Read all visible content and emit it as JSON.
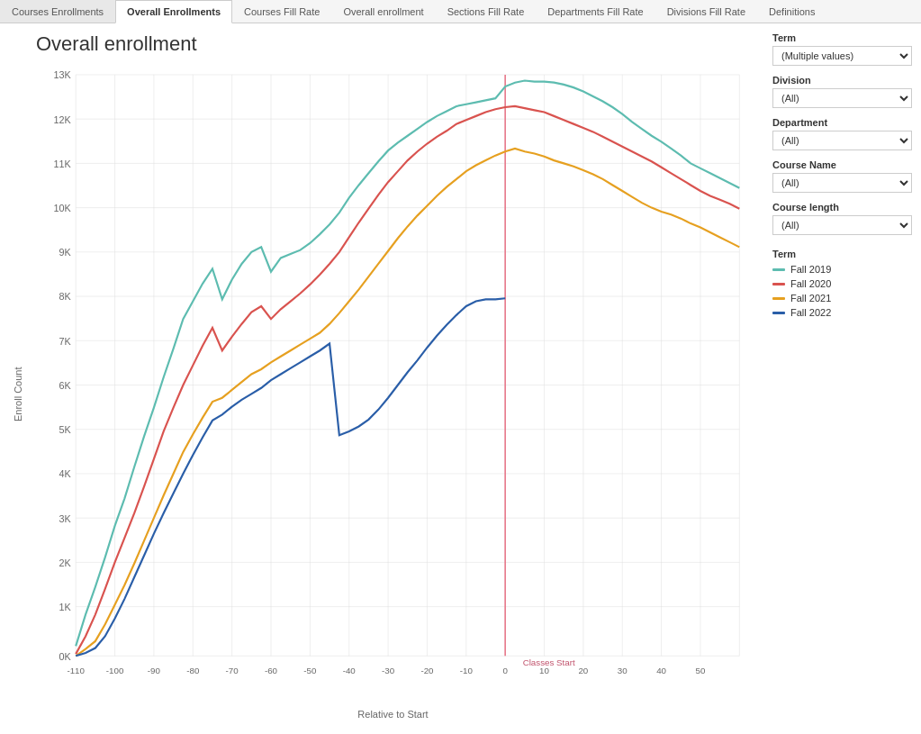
{
  "tabs": [
    {
      "label": "Courses Enrollments",
      "active": false
    },
    {
      "label": "Overall Enrollments",
      "active": true
    },
    {
      "label": "Courses Fill Rate",
      "active": false
    },
    {
      "label": "Overall enrollment",
      "active": false
    },
    {
      "label": "Sections Fill Rate",
      "active": false
    },
    {
      "label": "Departments Fill Rate",
      "active": false
    },
    {
      "label": "Divisions Fill Rate",
      "active": false
    },
    {
      "label": "Definitions",
      "active": false
    }
  ],
  "page_title": "Overall enrollment",
  "filters": {
    "term": {
      "label": "Term",
      "value": "(Multiple values)"
    },
    "division": {
      "label": "Division",
      "value": "(All)"
    },
    "department": {
      "label": "Department",
      "value": "(All)"
    },
    "course_name": {
      "label": "Course Name",
      "value": "(All)"
    },
    "course_length": {
      "label": "Course length",
      "value": "(All)"
    }
  },
  "legend": {
    "title": "Term",
    "items": [
      {
        "label": "Fall 2019",
        "color": "#5dbcb0"
      },
      {
        "label": "Fall 2020",
        "color": "#d9534f"
      },
      {
        "label": "Fall 2021",
        "color": "#e6a020"
      },
      {
        "label": "Fall 2022",
        "color": "#2a5ea8"
      }
    ]
  },
  "chart": {
    "y_axis_label": "Enroll Count",
    "x_axis_label": "Relative to Start",
    "y_ticks": [
      "13K",
      "12K",
      "11K",
      "10K",
      "9K",
      "8K",
      "7K",
      "6K",
      "5K",
      "4K",
      "3K",
      "2K",
      "1K",
      "0K"
    ],
    "x_ticks": [
      "-110",
      "-100",
      "-90",
      "-80",
      "-70",
      "-60",
      "-50",
      "-40",
      "-30",
      "-20",
      "-10",
      "0",
      "10",
      "20",
      "30",
      "40",
      "50"
    ],
    "reference_line_label": "Classes Start",
    "colors": {
      "fall2019": "#5dbcb0",
      "fall2020": "#d9534f",
      "fall2021": "#e6a020",
      "fall2022": "#2a5ea8"
    }
  }
}
